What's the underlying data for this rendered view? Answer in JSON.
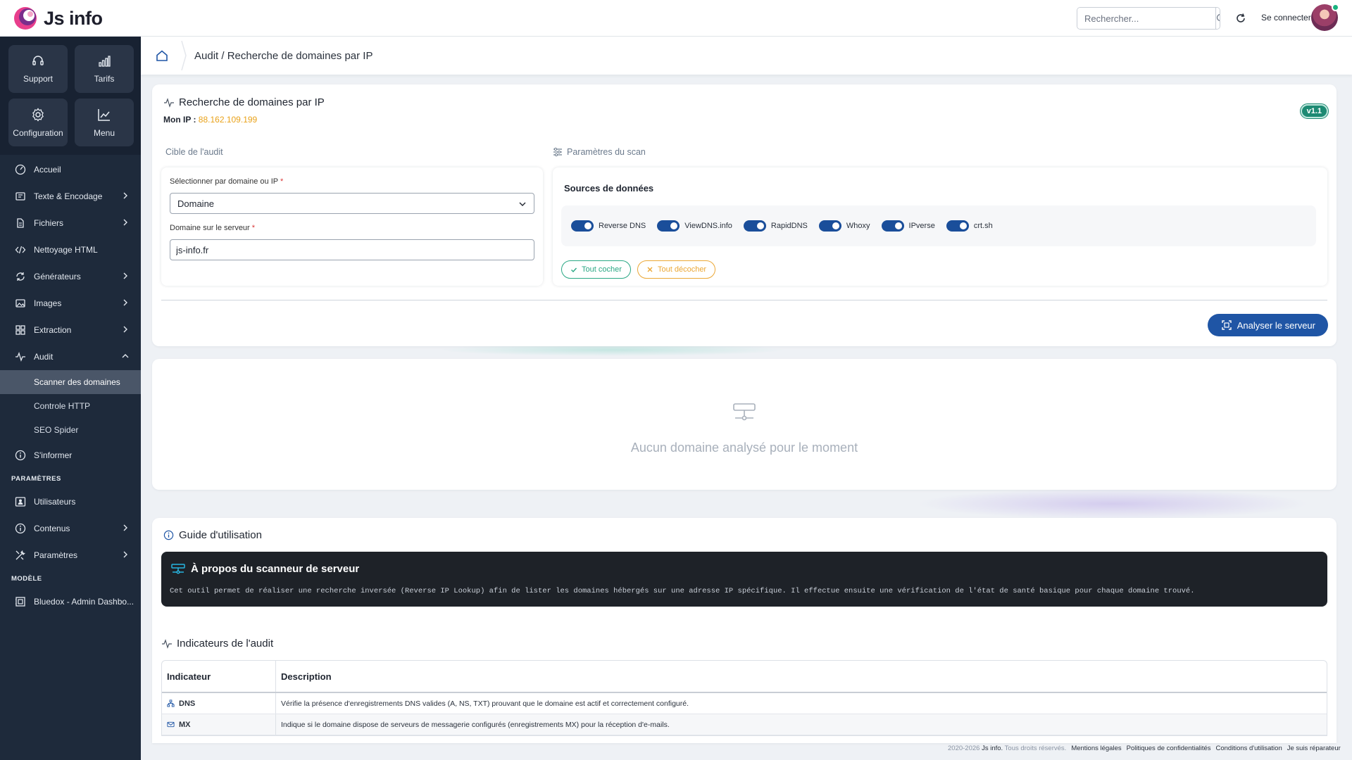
{
  "app": {
    "name": "Js info"
  },
  "header": {
    "search_placeholder": "Rechercher...",
    "login_label": "Se connecter"
  },
  "sidebar": {
    "quick": [
      {
        "label": "Support",
        "icon": "headset-icon"
      },
      {
        "label": "Tarifs",
        "icon": "bar-chart-icon"
      },
      {
        "label": "Configuration",
        "icon": "gear-icon"
      },
      {
        "label": "Menu",
        "icon": "trend-chart-icon"
      }
    ],
    "items": {
      "accueil": "Accueil",
      "texte": "Texte & Encodage",
      "fichiers": "Fichiers",
      "nettoyage": "Nettoyage HTML",
      "generateurs": "Générateurs",
      "images": "Images",
      "extraction": "Extraction",
      "audit": "Audit",
      "scanner": "Scanner des domaines",
      "controle": "Controle HTTP",
      "seo": "SEO Spider",
      "informer": "S'informer",
      "section_params": "PARAMÈTRES",
      "utilisateurs": "Utilisateurs",
      "contenus": "Contenus",
      "parametres": "Paramètres",
      "section_modele": "MODÈLE",
      "bluedox": "Bluedox - Admin Dashbo..."
    }
  },
  "breadcrumb": {
    "text": "Audit / Recherche de domaines par IP"
  },
  "audit": {
    "title": "Recherche de domaines par IP",
    "my_ip_label": "Mon IP :",
    "my_ip_value": "88.162.109.199",
    "version": "v1.1",
    "target_title": "Cible de l'audit",
    "params_title": "Paramètres du scan",
    "select_label": "Sélectionner par domaine ou IP",
    "select_value": "Domaine",
    "domain_label": "Domaine sur le serveur",
    "domain_value": "js-info.fr",
    "required_mark": "*",
    "sources_title": "Sources de données",
    "sources": [
      "Reverse DNS",
      "ViewDNS.info",
      "RapidDNS",
      "Whoxy",
      "IPverse",
      "crt.sh"
    ],
    "check_all": "Tout cocher",
    "uncheck_all": "Tout décocher",
    "analyze": "Analyser le serveur"
  },
  "empty": {
    "text": "Aucun domaine analysé pour le moment"
  },
  "guide": {
    "title": "Guide d'utilisation",
    "about_title": "À propos du scanneur de serveur",
    "about_text": "Cet outil permet de réaliser une recherche inversée (Reverse IP Lookup) afin de lister les domaines hébergés sur une adresse IP spécifique. Il effectue ensuite une vérification de l'état de santé basique pour chaque domaine trouvé.",
    "indicators_title": "Indicateurs de l'audit",
    "col_indicator": "Indicateur",
    "col_description": "Description",
    "rows": [
      {
        "name": "DNS",
        "desc": "Vérifie la présence d'enregistrements DNS valides (A, NS, TXT) prouvant que le domaine est actif et correctement configuré."
      },
      {
        "name": "MX",
        "desc": "Indique si le domaine dispose de serveurs de messagerie configurés (enregistrements MX) pour la réception d'e-mails."
      }
    ]
  },
  "footer": {
    "copyright": "2020-2026",
    "brand": "Js info.",
    "rights": "Tous droits réservés.",
    "links": [
      "Mentions légales",
      "Politiques de confidentialités",
      "Conditions d'utilisation",
      "Je suis réparateur"
    ]
  },
  "colors": {
    "accent": "#1f55a5",
    "sidebar": "#1e2a3b",
    "ip": "#e9a21a",
    "success": "#2aa784",
    "warning": "#eba735",
    "badge": "#1d8a73"
  }
}
